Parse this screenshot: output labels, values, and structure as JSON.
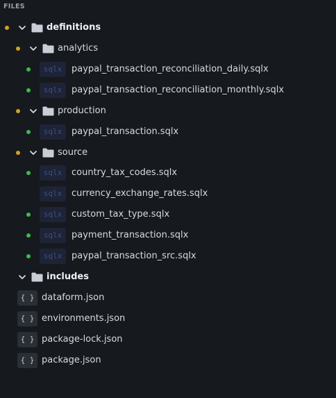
{
  "header": {
    "title": "FILES"
  },
  "tree": {
    "definitions": {
      "label": "definitions",
      "status": "modified",
      "analytics": {
        "label": "analytics",
        "status": "modified",
        "files": [
          {
            "badge": "sqlx",
            "name": "paypal_transaction_reconciliation_daily.sqlx",
            "status": "added"
          },
          {
            "badge": "sqlx",
            "name": "paypal_transaction_reconciliation_monthly.sqlx",
            "status": "added"
          }
        ]
      },
      "production": {
        "label": "production",
        "status": "modified",
        "files": [
          {
            "badge": "sqlx",
            "name": "paypal_transaction.sqlx",
            "status": "added"
          }
        ]
      },
      "source": {
        "label": "source",
        "status": "modified",
        "files": [
          {
            "badge": "sqlx",
            "name": "country_tax_codes.sqlx",
            "status": "added"
          },
          {
            "badge": "sqlx",
            "name": "currency_exchange_rates.sqlx",
            "status": "none"
          },
          {
            "badge": "sqlx",
            "name": "custom_tax_type.sqlx",
            "status": "added"
          },
          {
            "badge": "sqlx",
            "name": "payment_transaction.sqlx",
            "status": "added"
          },
          {
            "badge": "sqlx",
            "name": "paypal_transaction_src.sqlx",
            "status": "added"
          }
        ]
      }
    },
    "includes": {
      "label": "includes",
      "status": "none"
    },
    "root_files": [
      {
        "badge": "{ }",
        "name": "dataform.json"
      },
      {
        "badge": "{ }",
        "name": "environments.json"
      },
      {
        "badge": "{ }",
        "name": "package-lock.json"
      },
      {
        "badge": "{ }",
        "name": "package.json"
      }
    ]
  },
  "colors": {
    "background": "#16191e",
    "modified_dot": "#d4a21e",
    "added_dot": "#3fb950",
    "sqlx_badge_bg": "#1e2436",
    "sqlx_badge_text": "#3c4d8a"
  },
  "icons": {
    "expanded": "chevron-down-icon",
    "folder": "folder-icon"
  }
}
